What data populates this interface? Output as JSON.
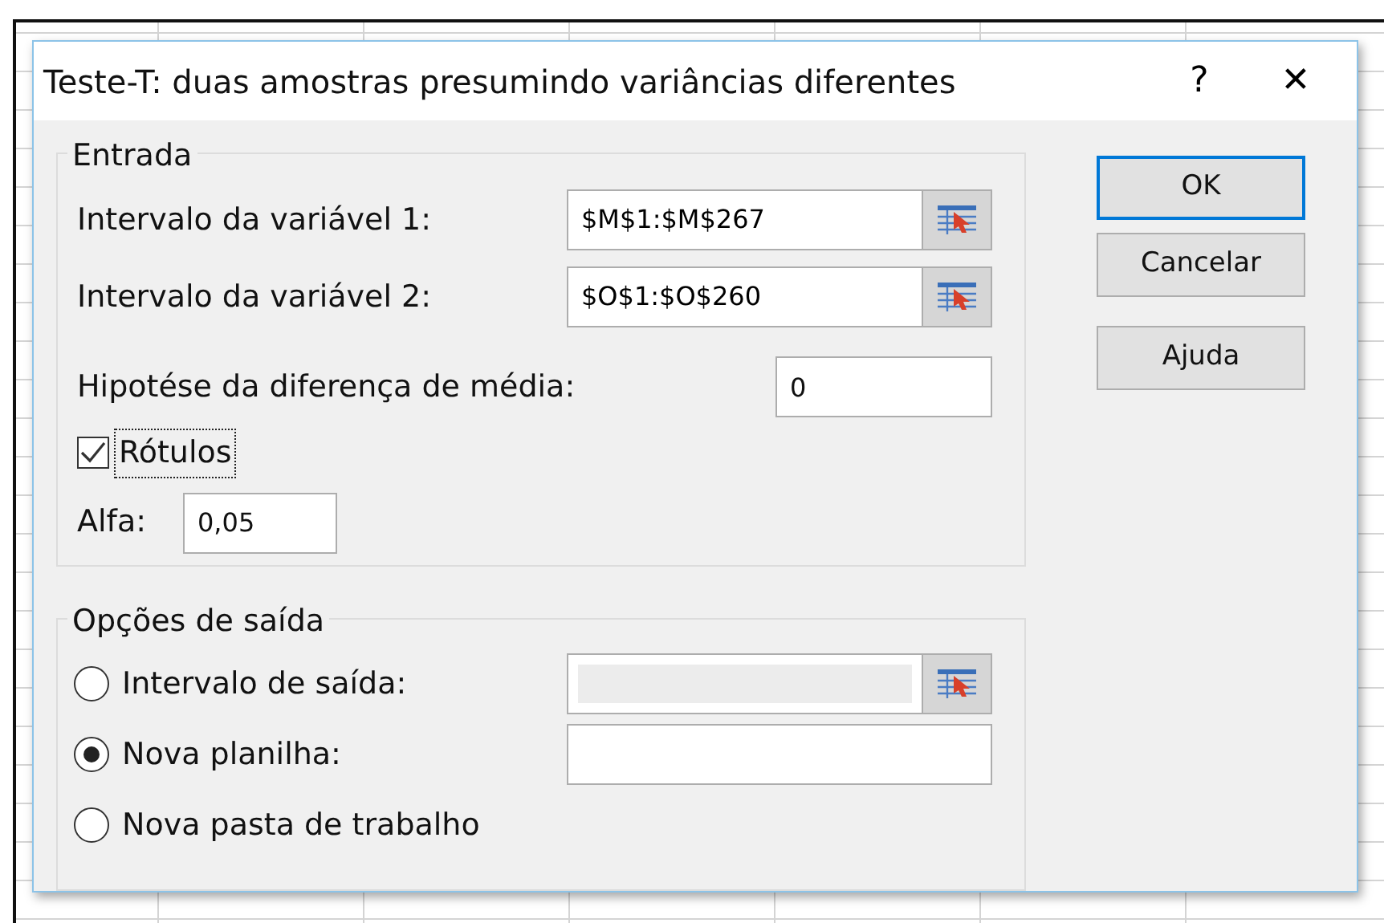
{
  "window": {
    "title": "Teste-T: duas amostras presumindo variâncias diferentes",
    "help": "?",
    "close": "✕"
  },
  "input_group": {
    "title": "Entrada",
    "ranges": [
      {
        "label": "Intervalo da variável 1:",
        "value": "$M$1:$M$267"
      },
      {
        "label": "Intervalo da variável 2:",
        "value": "$O$1:$O$260"
      }
    ],
    "hypothesis": {
      "label": "Hipotése da diferença de média:",
      "value": "0"
    },
    "labels_checkbox": {
      "label": "Rótulos",
      "checked": true,
      "focused": true
    },
    "alpha": {
      "label": "Alfa:",
      "value": "0,05"
    }
  },
  "output_group": {
    "title": "Opções de saída",
    "options": [
      {
        "label": "Intervalo de saída:",
        "selected": false,
        "kind": "range",
        "disabled": true
      },
      {
        "label": "Nova planilha:",
        "selected": true,
        "kind": "text",
        "disabled": false
      },
      {
        "label": "Nova pasta de trabalho",
        "selected": false,
        "kind": "plain"
      }
    ]
  },
  "buttons": [
    {
      "label": "OK",
      "default": true
    },
    {
      "label": "Cancelar",
      "default": false
    },
    {
      "label": "Ajuda",
      "default": false
    }
  ]
}
